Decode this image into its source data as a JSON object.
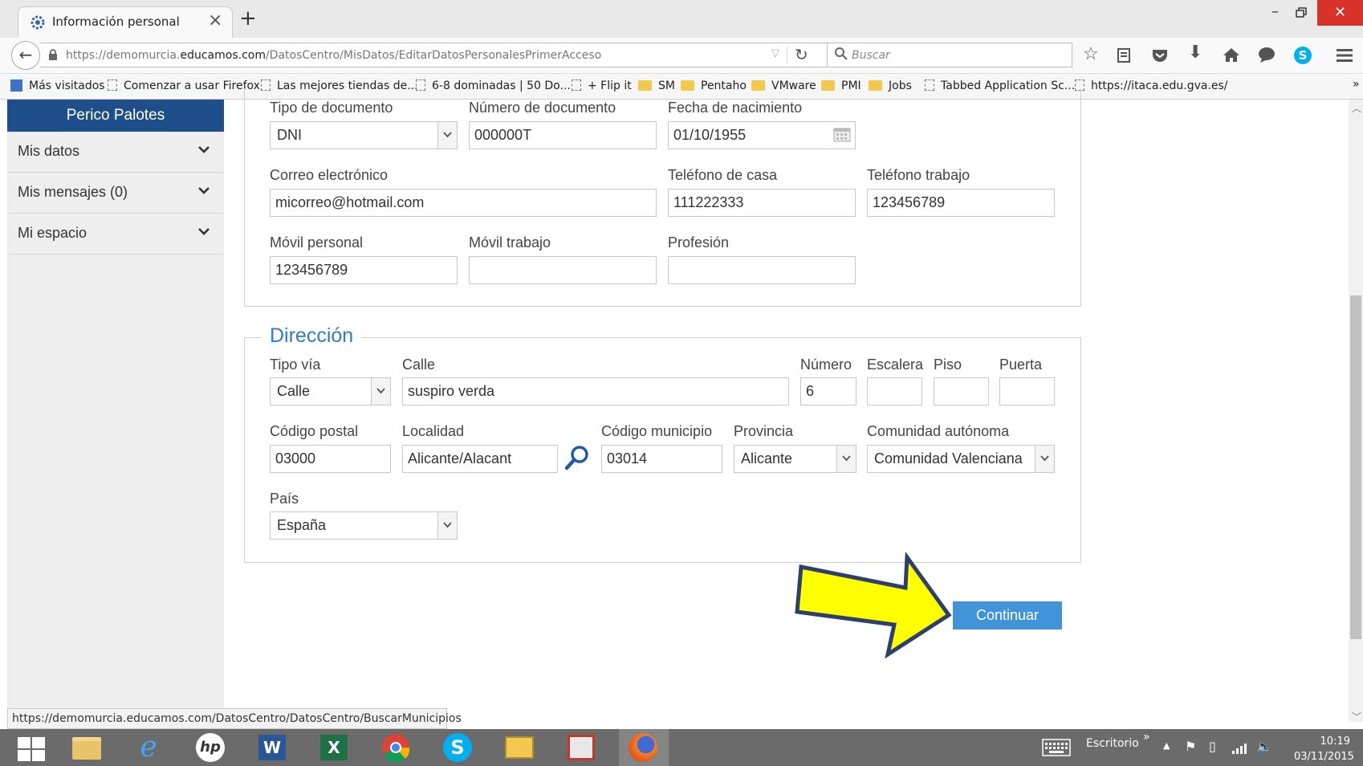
{
  "browser": {
    "tab_title": "Información personal",
    "new_tab": "+",
    "url_prefix": "https://demomurcia.",
    "url_domain": "educamos.com",
    "url_path": "/DatosCentro/MisDatos/EditarDatosPersonalesPrimerAcceso",
    "search_placeholder": "Buscar",
    "bookmarks": [
      {
        "label": "Más visitados",
        "kind": "icon"
      },
      {
        "label": "Comenzar a usar Firefox",
        "kind": "page"
      },
      {
        "label": "Las mejores tiendas de...",
        "kind": "page"
      },
      {
        "label": "6-8 dominadas | 50 Do...",
        "kind": "page"
      },
      {
        "label": "+ Flip it",
        "kind": "page"
      },
      {
        "label": "SM",
        "kind": "folder"
      },
      {
        "label": "Pentaho",
        "kind": "folder"
      },
      {
        "label": "VMware",
        "kind": "folder"
      },
      {
        "label": "PMI",
        "kind": "folder"
      },
      {
        "label": "Jobs",
        "kind": "folder"
      },
      {
        "label": "Tabbed Application Sc...",
        "kind": "page"
      },
      {
        "label": "https://itaca.edu.gva.es/",
        "kind": "page"
      }
    ],
    "bookmarks_more": "»",
    "status_url": "https://demomurcia.educamos.com/DatosCentro/DatosCentro/BuscarMunicipios"
  },
  "sidebar": {
    "user_name": "Perico Palotes",
    "items": [
      {
        "label": "Mis datos"
      },
      {
        "label": "Mis mensajes (0)"
      },
      {
        "label": "Mi espacio"
      }
    ]
  },
  "personal": {
    "tipo_documento_label": "Tipo de documento",
    "tipo_documento_value": "DNI",
    "numero_documento_label": "Número de documento",
    "numero_documento_value": "000000T",
    "fecha_nacimiento_label": "Fecha de nacimiento",
    "fecha_nacimiento_value": "01/10/1955",
    "correo_label": "Correo electrónico",
    "correo_value": "micorreo@hotmail.com",
    "tel_casa_label": "Teléfono de casa",
    "tel_casa_value": "111222333",
    "tel_trabajo_label": "Teléfono trabajo",
    "tel_trabajo_value": "123456789",
    "movil_personal_label": "Móvil personal",
    "movil_personal_value": "123456789",
    "movil_trabajo_label": "Móvil trabajo",
    "movil_trabajo_value": "",
    "profesion_label": "Profesión",
    "profesion_value": ""
  },
  "direccion": {
    "legend": "Dirección",
    "tipo_via_label": "Tipo vía",
    "tipo_via_value": "Calle",
    "calle_label": "Calle",
    "calle_value": "suspiro verda",
    "numero_label": "Número",
    "numero_value": "6",
    "escalera_label": "Escalera",
    "escalera_value": "",
    "piso_label": "Piso",
    "piso_value": "",
    "puerta_label": "Puerta",
    "puerta_value": "",
    "cp_label": "Código postal",
    "cp_value": "03000",
    "localidad_label": "Localidad",
    "localidad_value": "Alicante/Alacant",
    "cod_municipio_label": "Código municipio",
    "cod_municipio_value": "03014",
    "provincia_label": "Provincia",
    "provincia_value": "Alicante",
    "comunidad_label": "Comunidad autónoma",
    "comunidad_value": "Comunidad Valenciana",
    "pais_label": "País",
    "pais_value": "España"
  },
  "actions": {
    "continuar": "Continuar"
  },
  "taskbar": {
    "desktop_label": "Escritorio",
    "desktop_more": "»",
    "time": "10:19",
    "date": "03/11/2015"
  },
  "colors": {
    "sidebar_header": "#1f4f8a",
    "accent": "#2e7dc4",
    "button": "#4294d8",
    "arrow_fill": "#ffff00",
    "arrow_stroke": "#2d3f6e"
  }
}
